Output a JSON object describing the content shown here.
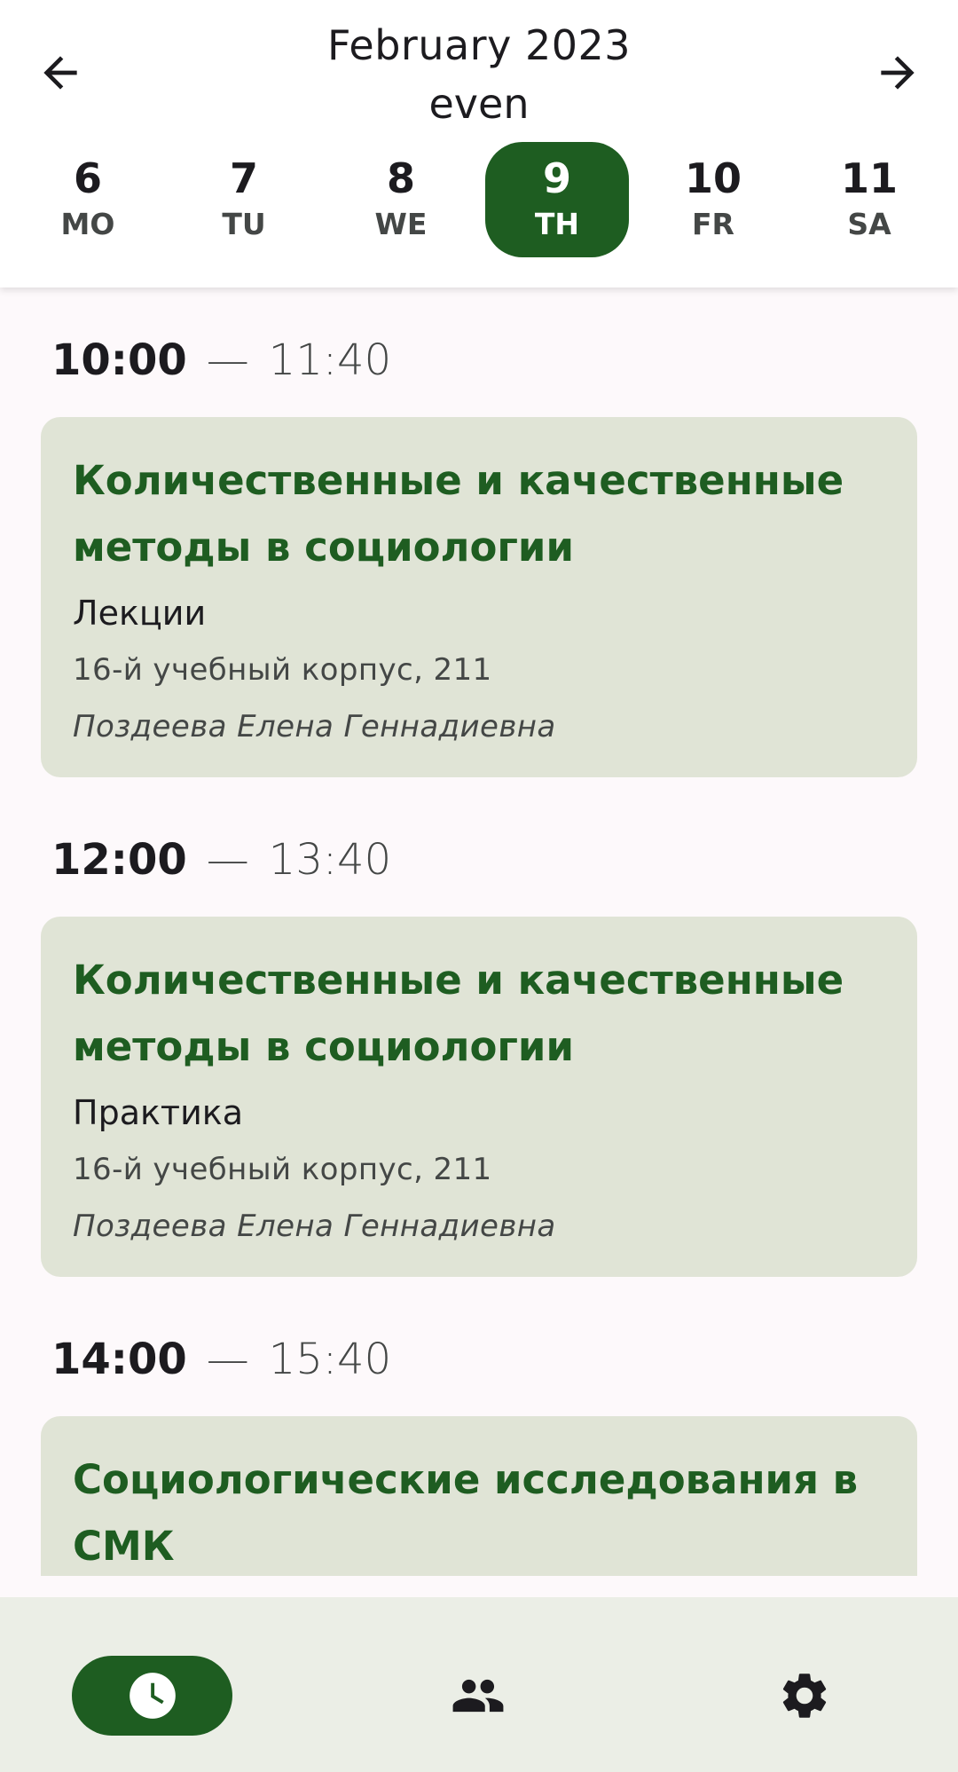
{
  "header": {
    "month": "February 2023",
    "week_parity": "even",
    "prev_icon": "arrow-left-icon",
    "next_icon": "arrow-right-icon"
  },
  "days": [
    {
      "num": "6",
      "wd": "MO",
      "selected": false
    },
    {
      "num": "7",
      "wd": "TU",
      "selected": false
    },
    {
      "num": "8",
      "wd": "WE",
      "selected": false
    },
    {
      "num": "9",
      "wd": "TH",
      "selected": true
    },
    {
      "num": "10",
      "wd": "FR",
      "selected": false
    },
    {
      "num": "11",
      "wd": "SA",
      "selected": false
    }
  ],
  "lessons": [
    {
      "start": "10:00",
      "dash": "—",
      "end": "11:40",
      "title": "Количественные и качественные методы в социологии",
      "type": "Лекции",
      "room": "16-й учебный корпус, 211",
      "teacher": "Поздеева Елена Геннадиевна"
    },
    {
      "start": "12:00",
      "dash": "—",
      "end": "13:40",
      "title": "Количественные и качественные методы в социологии",
      "type": "Практика",
      "room": "16-й учебный корпус, 211",
      "teacher": "Поздеева Елена Геннадиевна"
    },
    {
      "start": "14:00",
      "dash": "—",
      "end": "15:40",
      "title": "Социологические исследования в СМК",
      "type": "",
      "room": "",
      "teacher": ""
    }
  ],
  "bottom_nav": [
    {
      "name": "schedule",
      "icon": "clock-icon",
      "active": true
    },
    {
      "name": "groups",
      "icon": "people-icon",
      "active": false
    },
    {
      "name": "settings",
      "icon": "gear-icon",
      "active": false
    }
  ],
  "colors": {
    "accent": "#1e5d21",
    "card_bg": "#e0e4d6",
    "nav_bg": "#ebeee6",
    "page_bg": "#fdf9fb"
  }
}
